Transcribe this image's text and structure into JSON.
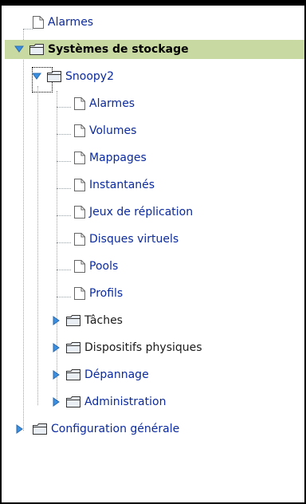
{
  "tree": {
    "root_alarmes": {
      "label": "Alarmes",
      "icon": "document-icon"
    },
    "systemes": {
      "label": "Systèmes de stockage",
      "expanded": true,
      "selected": true,
      "highlight_color": "#c9d9a2",
      "children": {
        "snoopy": {
          "label": "Snoopy2",
          "expanded": true,
          "items": [
            {
              "label": "Alarmes"
            },
            {
              "label": "Volumes"
            },
            {
              "label": "Mappages"
            },
            {
              "label": "Instantanés"
            },
            {
              "label": "Jeux de réplication"
            },
            {
              "label": "Disques virtuels"
            },
            {
              "label": "Pools"
            },
            {
              "label": "Profils"
            }
          ],
          "folders": [
            {
              "label": "Tâches"
            },
            {
              "label": "Dispositifs physiques"
            },
            {
              "label": "Dépannage"
            },
            {
              "label": "Administration"
            }
          ]
        }
      }
    },
    "config": {
      "label": "Configuration générale",
      "expanded": false
    }
  },
  "colors": {
    "link_text": "#0b2a9e",
    "toggle_blue": "#3b8fe0",
    "folder_fill": "#e9eef5",
    "folder_stroke": "#333333"
  }
}
